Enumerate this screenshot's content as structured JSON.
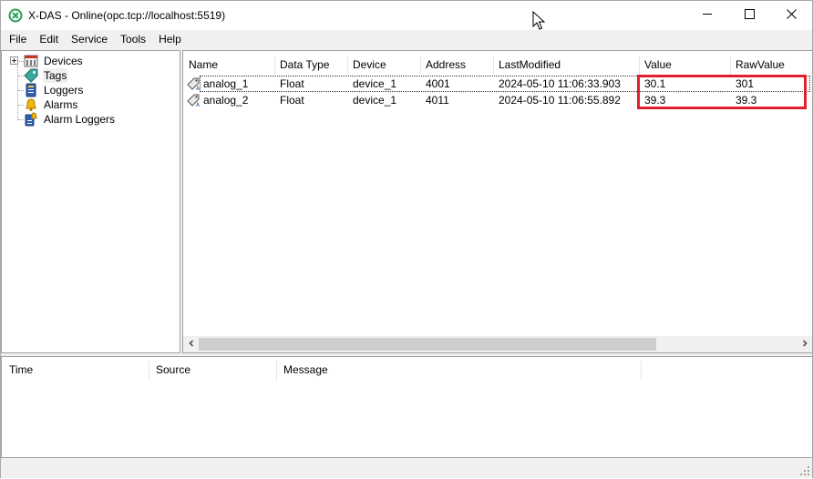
{
  "window": {
    "title": "X-DAS - Online(opc.tcp://localhost:5519)",
    "icon": "xdas-app-icon",
    "controls": {
      "minimize": "minimize-icon",
      "maximize": "maximize-icon",
      "close": "close-icon"
    }
  },
  "menu": {
    "items": [
      "File",
      "Edit",
      "Service",
      "Tools",
      "Help"
    ]
  },
  "tree": {
    "items": [
      {
        "label": "Devices",
        "icon": "devices-icon",
        "expandable": true
      },
      {
        "label": "Tags",
        "icon": "tags-icon",
        "selected": true
      },
      {
        "label": "Loggers",
        "icon": "loggers-icon"
      },
      {
        "label": "Alarms",
        "icon": "alarms-icon"
      },
      {
        "label": "Alarm Loggers",
        "icon": "alarm-loggers-icon"
      }
    ]
  },
  "tag_list": {
    "columns": [
      "Name",
      "Data Type",
      "Device",
      "Address",
      "LastModified",
      "Value",
      "RawValue"
    ],
    "rows": [
      [
        "analog_1",
        "Float",
        "device_1",
        "4001",
        "2024-05-10 11:06:33.903",
        "30.1",
        "301"
      ],
      [
        "analog_2",
        "Float",
        "device_1",
        "4011",
        "2024-05-10 11:06:55.892",
        "39.3",
        "39.3"
      ]
    ],
    "highlight_color": "#e0202a"
  },
  "log": {
    "columns": [
      "Time",
      "Source",
      "Message"
    ]
  },
  "colors": {
    "chrome": "#f0f0f0",
    "pane_border": "#a0a0a0",
    "highlight": "#e0202a"
  }
}
